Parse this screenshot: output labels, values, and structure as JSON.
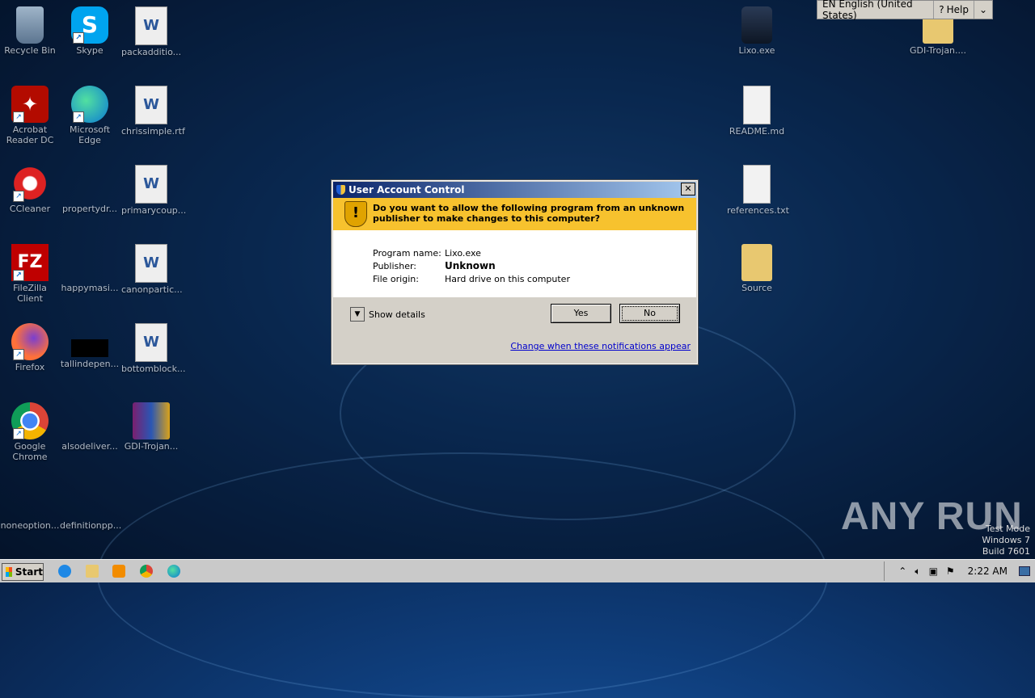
{
  "desktop": {
    "icons": [
      {
        "label": "Recycle Bin"
      },
      {
        "label": "Skype"
      },
      {
        "label": "packadditio..."
      },
      {
        "label": "Acrobat Reader DC"
      },
      {
        "label": "Microsoft Edge"
      },
      {
        "label": "chrissimple.rtf"
      },
      {
        "label": "CCleaner"
      },
      {
        "label": "propertydr..."
      },
      {
        "label": "primarycoup..."
      },
      {
        "label": "FileZilla Client"
      },
      {
        "label": "happymasi..."
      },
      {
        "label": "canonpartic..."
      },
      {
        "label": "Firefox"
      },
      {
        "label": "tallindepen..."
      },
      {
        "label": "bottomblock..."
      },
      {
        "label": "Google Chrome"
      },
      {
        "label": "alsodeliver..."
      },
      {
        "label": "GDI-Trojan..."
      },
      {
        "label": "noneoption..."
      },
      {
        "label": "definitionpp..."
      },
      {
        "label": "Lixo.exe"
      },
      {
        "label": "GDI-Trojan...."
      },
      {
        "label": "README.md"
      },
      {
        "label": "references.txt"
      },
      {
        "label": "Source"
      }
    ]
  },
  "language_bar": {
    "lang": "EN English (United States)",
    "help": "Help"
  },
  "uac": {
    "title": "User Account Control",
    "close": "✕",
    "question": "Do you want to allow the following program from an unknown publisher to make changes to this computer?",
    "program_label": "Program name:",
    "program_value": "Lixo.exe",
    "publisher_label": "Publisher:",
    "publisher_value": "Unknown",
    "origin_label": "File origin:",
    "origin_value": "Hard drive on this computer",
    "show_details": "Show details",
    "yes": "Yes",
    "no": "No",
    "link": "Change when these notifications appear"
  },
  "taskbar": {
    "start": "Start",
    "clock": "2:22 AM"
  },
  "watermark": {
    "text": "ANY RUN",
    "line1": "Test Mode",
    "line2": "Windows 7",
    "line3": "Build 7601"
  }
}
